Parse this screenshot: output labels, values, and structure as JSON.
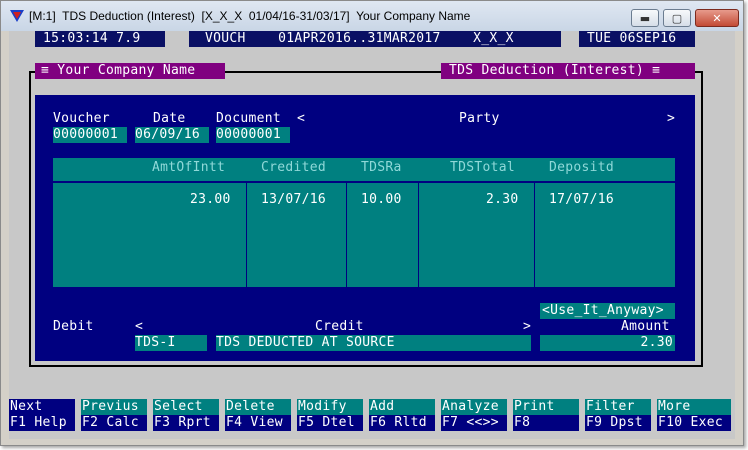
{
  "window": {
    "title": "[M:1]  TDS Deduction (Interest)  [X_X_X  01/04/16-31/03/17]  Your Company Name",
    "controls": {
      "minimize": "▬",
      "maximize": "▢",
      "close": "✕"
    }
  },
  "status": {
    "clock": "15:03:14 7.9",
    "mode": "VOUCH    01APR2016..31MAR2017    X_X_X",
    "date": "TUE 06SEP16"
  },
  "frame": {
    "company": "≡ Your Company Name",
    "screen": "TDS Deduction (Interest) ≡"
  },
  "voucher": {
    "labels": {
      "voucher": "Voucher",
      "date": "Date",
      "document": "Document",
      "party": "Party",
      "lt": "<",
      "gt": ">"
    },
    "values": {
      "voucher": "00000001",
      "date": "06/09/16",
      "document": "00000001",
      "party_code": "",
      "party_name": ""
    }
  },
  "grid": {
    "columns": [
      "AmtOfIntt",
      "Credited",
      "TDSRa",
      "TDSTotal",
      "Depositd"
    ],
    "rows": [
      {
        "amt": "23.00",
        "credited": "13/07/16",
        "rate": "10.00",
        "total": "2.30",
        "deposited": "17/07/16"
      }
    ]
  },
  "footer": {
    "use_anyway": "<Use_It_Anyway>",
    "debit_label": "Debit",
    "credit_label": "Credit",
    "amount_label": "Amount",
    "lt": "<",
    "gt": ">",
    "debit_value": "",
    "credit_code": "TDS-I",
    "credit_name": "TDS DEDUCTED AT SOURCE",
    "amount_value": "2.30"
  },
  "fkeys": [
    {
      "top": "Next",
      "bottom": "F1 Help"
    },
    {
      "top": "Previus",
      "bottom": "F2 Calc"
    },
    {
      "top": "Select",
      "bottom": "F3 Rprt"
    },
    {
      "top": "Delete",
      "bottom": "F4 View"
    },
    {
      "top": "Modify",
      "bottom": "F5 Dtel"
    },
    {
      "top": "Add",
      "bottom": "F6 Rltd"
    },
    {
      "top": "Analyze",
      "bottom": "F7 <<>>"
    },
    {
      "top": "Print",
      "bottom": "F8"
    },
    {
      "top": "Filter",
      "bottom": "F9 Dpst"
    },
    {
      "top": "More",
      "bottom": "F10 Exec"
    }
  ],
  "colors": {
    "navy": "#000080",
    "teal": "#008080",
    "purple": "#800080",
    "gray": "#c8c8c8",
    "title_icon": "#1a3ec8"
  }
}
